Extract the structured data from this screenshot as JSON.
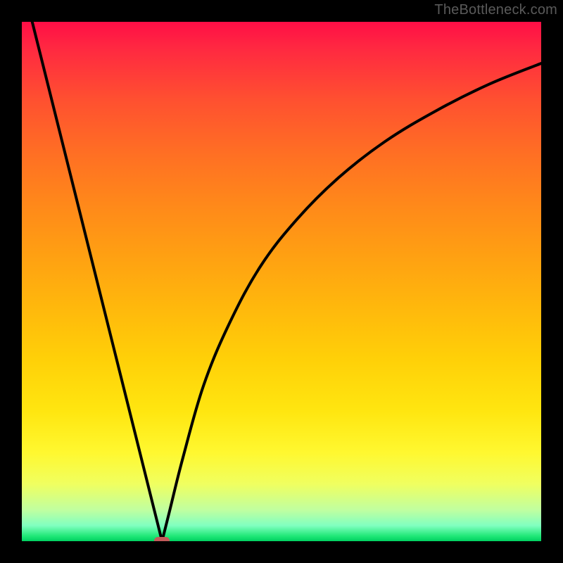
{
  "attribution": "TheBottleneck.com",
  "colors": {
    "frame": "#000000",
    "curve": "#000000",
    "marker": "#c35a5a"
  },
  "chart_data": {
    "type": "line",
    "title": "",
    "xlabel": "",
    "ylabel": "",
    "xlim": [
      0,
      100
    ],
    "ylim": [
      0,
      100
    ],
    "grid": false,
    "legend": false,
    "background_gradient": "red-orange-yellow-green (top to bottom)",
    "marker": {
      "x": 27,
      "y": 0,
      "shape": "rounded-rect"
    },
    "series": [
      {
        "name": "left-branch",
        "x": [
          2,
          6,
          10,
          14,
          18,
          22,
          25.5,
          27
        ],
        "y": [
          100,
          84,
          68,
          52,
          36,
          20,
          6,
          0
        ]
      },
      {
        "name": "right-branch",
        "x": [
          27,
          28.5,
          31,
          35,
          40,
          46,
          53,
          61,
          70,
          80,
          90,
          100
        ],
        "y": [
          0,
          6,
          16,
          30,
          42,
          53,
          62,
          70,
          77,
          83,
          88,
          92
        ]
      }
    ],
    "note": "Axes have no visible tick labels; x/y values are estimated on a 0–100 grid from pixel positions."
  }
}
